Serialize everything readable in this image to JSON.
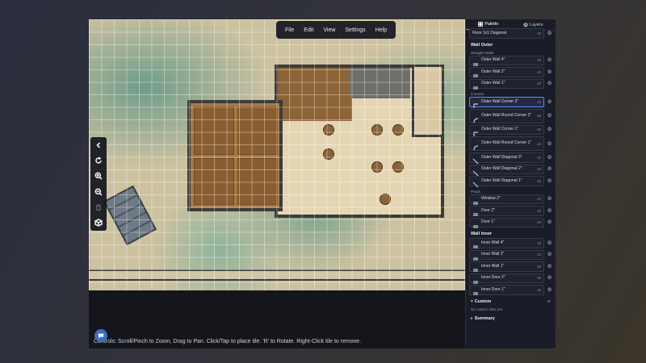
{
  "menu": [
    "File",
    "Edit",
    "View",
    "Settings",
    "Help"
  ],
  "toolbar": {
    "icons": [
      "chevron-left-icon",
      "rotate-icon",
      "zoom-in-icon",
      "zoom-out-icon",
      "trash-icon",
      "cube-icon"
    ]
  },
  "controls_text": "Controls: Scroll/Pinch to Zoom, Drag to Pan. Click/Tap to place tile. 'R' to Rotate. Right-Click tile to remove.",
  "panel": {
    "tabs": {
      "palette": "Palette",
      "layers": "Layers"
    },
    "top_item": {
      "label": "Floor 1x1 Diagonal",
      "count": "x0"
    },
    "wall_outer": {
      "title": "Wall Outer",
      "straight_title": "Straight Walls",
      "straight": [
        {
          "label": "Outer Wall 4\"",
          "count": "x0"
        },
        {
          "label": "Outer Wall 2\"",
          "count": "x0"
        },
        {
          "label": "Outer Wall 1\"",
          "count": "x0"
        }
      ],
      "corners_title": "Corners",
      "corners": [
        {
          "label": "Outer Wall Corner 2\"",
          "count": "x0"
        },
        {
          "label": "Outer Wall Round Corner 2\"",
          "count": "x0"
        },
        {
          "label": "Outer Wall Corner 1\"",
          "count": "x0"
        },
        {
          "label": "Outer Wall Round Corner 1\"",
          "count": "x0"
        },
        {
          "label": "Outer Wall Diagonal 3\"",
          "count": "x0"
        },
        {
          "label": "Outer Wall Diagonal 2\"",
          "count": "x0"
        },
        {
          "label": "Outer Wall Diagonal 1\"",
          "count": "x0"
        }
      ],
      "props_title": "Props",
      "props": [
        {
          "label": "Window 2\"",
          "count": "x0"
        },
        {
          "label": "Door 2\"",
          "count": "x0"
        },
        {
          "label": "Door 1\"",
          "count": "x0"
        }
      ]
    },
    "wall_inner": {
      "title": "Wall Inner",
      "items": [
        {
          "label": "Inner Wall 4\"",
          "count": "x0"
        },
        {
          "label": "Inner Wall 2\"",
          "count": "x0"
        },
        {
          "label": "Inner Wall 1\"",
          "count": "x0"
        },
        {
          "label": "Inner Door 2\"",
          "count": "x0"
        },
        {
          "label": "Inner Door 1\"",
          "count": "x0"
        }
      ]
    },
    "custom": {
      "title": "Custom",
      "empty": "No custom tiles yet."
    },
    "summary": {
      "title": "Summary"
    }
  },
  "colors": {
    "accent": "#5b8cff",
    "panel_bg": "#1a1d28",
    "chat": "#3b6fc9"
  }
}
